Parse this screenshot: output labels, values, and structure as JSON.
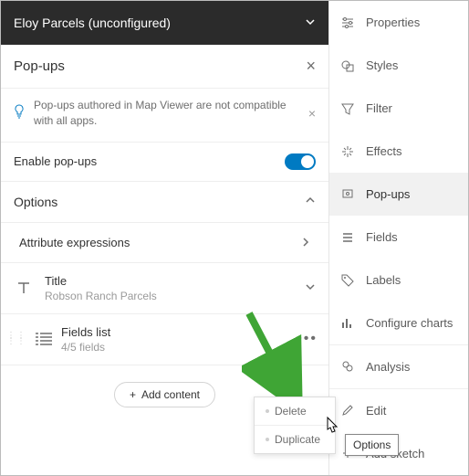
{
  "header": {
    "title": "Eloy Parcels (unconfigured)"
  },
  "panel": {
    "title": "Pop-ups",
    "info": "Pop-ups authored in Map Viewer are not compatible with all apps.",
    "toggle_label": "Enable pop-ups",
    "options_label": "Options",
    "attr_expr_label": "Attribute expressions",
    "title_card": {
      "label": "Title",
      "value": "Robson Ranch Parcels"
    },
    "fields_card": {
      "label": "Fields list",
      "value": "4/5 fields"
    },
    "add_content": "Add content"
  },
  "context_menu": {
    "items": [
      "Delete",
      "Duplicate"
    ]
  },
  "tooltip": "Options",
  "side": {
    "items": [
      "Properties",
      "Styles",
      "Filter",
      "Effects",
      "Pop-ups",
      "Fields",
      "Labels",
      "Configure charts",
      "Analysis",
      "Edit",
      "Add sketch"
    ]
  }
}
